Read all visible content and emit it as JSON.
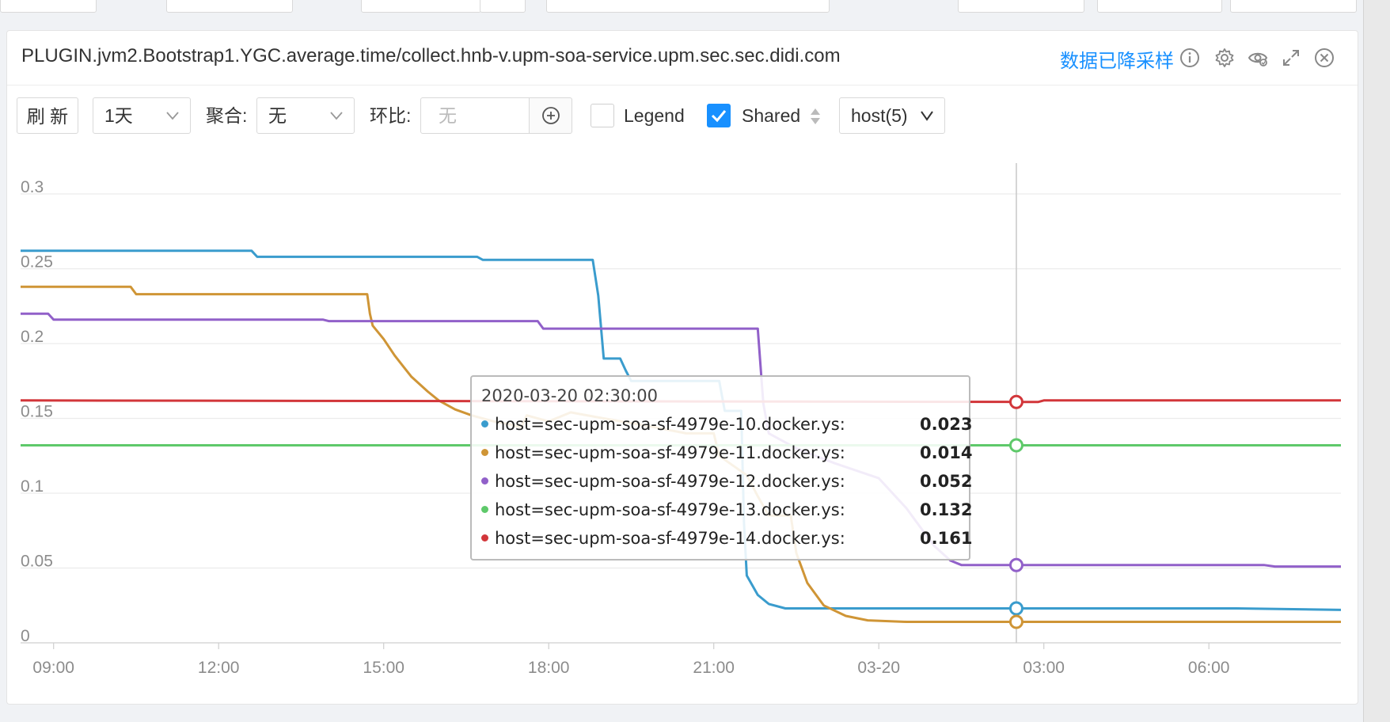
{
  "panel": {
    "title": "PLUGIN.jvm2.Bootstrap1.YGC.average.time/collect.hnb-v.upm-soa-service.upm.sec.sec.didi.com",
    "downsample_link": "数据已降采样",
    "icons": [
      "info-icon",
      "gear-icon",
      "eye-icon",
      "expand-icon",
      "close-icon"
    ]
  },
  "toolbar": {
    "refresh_label": "刷 新",
    "range_value": "1天",
    "aggregate_label": "聚合:",
    "aggregate_value": "无",
    "compare_label": "环比:",
    "compare_placeholder": "无",
    "legend_label": "Legend",
    "legend_checked": false,
    "shared_label": "Shared",
    "shared_checked": true,
    "host_value": "host(5)"
  },
  "colors": {
    "accent": "#1890ff",
    "series": [
      "#3a9ccd",
      "#cf9536",
      "#9160c9",
      "#5ec96a",
      "#d2363a"
    ]
  },
  "chart_data": {
    "type": "line",
    "ylim": [
      0,
      0.3
    ],
    "yticks": [
      "0",
      "0.05",
      "0.1",
      "0.15",
      "0.2",
      "0.25",
      "0.3"
    ],
    "xticks": [
      "09:00",
      "12:00",
      "15:00",
      "18:00",
      "21:00",
      "03-20",
      "03:00",
      "06:00"
    ],
    "x_unit": "hours since 09:00",
    "xrange": [
      -0.6,
      23.4
    ],
    "cursor_x": 17.5,
    "series": [
      {
        "name": "host=sec-upm-soa-sf-4979e-10.docker.ys",
        "points": [
          [
            -0.6,
            0.262
          ],
          [
            3.6,
            0.262
          ],
          [
            3.7,
            0.258
          ],
          [
            7.7,
            0.258
          ],
          [
            7.8,
            0.256
          ],
          [
            9.8,
            0.256
          ],
          [
            9.9,
            0.232
          ],
          [
            10.0,
            0.19
          ],
          [
            10.3,
            0.19
          ],
          [
            10.4,
            0.182
          ],
          [
            10.5,
            0.175
          ],
          [
            12.1,
            0.175
          ],
          [
            12.2,
            0.155
          ],
          [
            12.5,
            0.155
          ],
          [
            12.55,
            0.08
          ],
          [
            12.6,
            0.045
          ],
          [
            12.8,
            0.032
          ],
          [
            13.0,
            0.026
          ],
          [
            13.3,
            0.023
          ],
          [
            15.5,
            0.023
          ],
          [
            17.5,
            0.023
          ],
          [
            20.5,
            0.023
          ],
          [
            21.5,
            0.023
          ],
          [
            23.4,
            0.022
          ]
        ]
      },
      {
        "name": "host=sec-upm-soa-sf-4979e-11.docker.ys",
        "points": [
          [
            -0.6,
            0.238
          ],
          [
            1.4,
            0.238
          ],
          [
            1.5,
            0.233
          ],
          [
            5.7,
            0.233
          ],
          [
            5.75,
            0.22
          ],
          [
            5.8,
            0.212
          ],
          [
            6.0,
            0.203
          ],
          [
            6.2,
            0.192
          ],
          [
            6.5,
            0.178
          ],
          [
            6.8,
            0.168
          ],
          [
            7.0,
            0.162
          ],
          [
            7.3,
            0.156
          ],
          [
            7.6,
            0.152
          ],
          [
            8.0,
            0.148
          ],
          [
            8.3,
            0.146
          ],
          [
            8.5,
            0.144
          ],
          [
            8.6,
            0.152
          ],
          [
            9.0,
            0.148
          ],
          [
            9.4,
            0.154
          ],
          [
            10.0,
            0.15
          ],
          [
            10.8,
            0.145
          ],
          [
            11.5,
            0.14
          ],
          [
            12.0,
            0.14
          ],
          [
            12.1,
            0.125
          ],
          [
            12.6,
            0.112
          ],
          [
            12.8,
            0.098
          ],
          [
            13.0,
            0.085
          ],
          [
            13.4,
            0.085
          ],
          [
            13.5,
            0.06
          ],
          [
            13.7,
            0.04
          ],
          [
            14.0,
            0.025
          ],
          [
            14.4,
            0.018
          ],
          [
            14.8,
            0.015
          ],
          [
            15.5,
            0.014
          ],
          [
            17.5,
            0.014
          ],
          [
            23.4,
            0.014
          ]
        ]
      },
      {
        "name": "host=sec-upm-soa-sf-4979e-12.docker.ys",
        "points": [
          [
            -0.6,
            0.22
          ],
          [
            -0.1,
            0.22
          ],
          [
            0,
            0.216
          ],
          [
            4.9,
            0.216
          ],
          [
            5.0,
            0.215
          ],
          [
            8.8,
            0.215
          ],
          [
            8.9,
            0.21
          ],
          [
            12.8,
            0.21
          ],
          [
            12.9,
            0.16
          ],
          [
            13.0,
            0.14
          ],
          [
            13.5,
            0.13
          ],
          [
            14.2,
            0.12
          ],
          [
            15.0,
            0.11
          ],
          [
            15.5,
            0.09
          ],
          [
            16.0,
            0.065
          ],
          [
            16.3,
            0.055
          ],
          [
            16.5,
            0.052
          ],
          [
            17.5,
            0.052
          ],
          [
            22.0,
            0.052
          ],
          [
            22.2,
            0.051
          ],
          [
            23.4,
            0.051
          ]
        ]
      },
      {
        "name": "host=sec-upm-soa-sf-4979e-13.docker.ys",
        "points": [
          [
            -0.6,
            0.132
          ],
          [
            23.4,
            0.132
          ]
        ]
      },
      {
        "name": "host=sec-upm-soa-sf-4979e-14.docker.ys",
        "points": [
          [
            -0.6,
            0.162
          ],
          [
            17.5,
            0.161
          ],
          [
            17.9,
            0.161
          ],
          [
            18.0,
            0.162
          ],
          [
            23.4,
            0.162
          ]
        ]
      }
    ],
    "tooltip": {
      "time": "2020-03-20 02:30:00",
      "rows": [
        {
          "label": "host=sec-upm-soa-sf-4979e-10.docker.ys:",
          "value": "0.023"
        },
        {
          "label": "host=sec-upm-soa-sf-4979e-11.docker.ys:",
          "value": "0.014"
        },
        {
          "label": "host=sec-upm-soa-sf-4979e-12.docker.ys:",
          "value": "0.052"
        },
        {
          "label": "host=sec-upm-soa-sf-4979e-13.docker.ys:",
          "value": "0.132"
        },
        {
          "label": "host=sec-upm-soa-sf-4979e-14.docker.ys:",
          "value": "0.161"
        }
      ]
    }
  }
}
